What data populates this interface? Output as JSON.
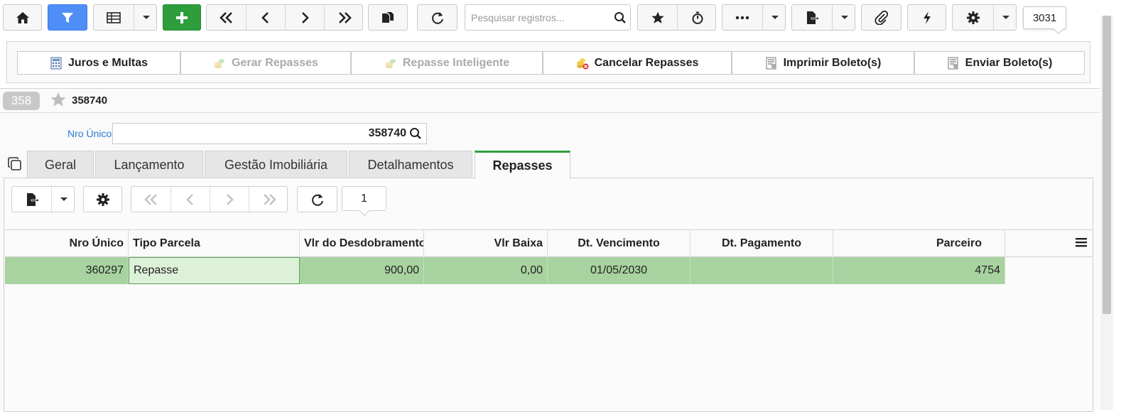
{
  "toolbar": {
    "search_placeholder": "Pesquisar registros...",
    "record_count": "3031"
  },
  "actions": [
    {
      "label": "Juros e Multas",
      "enabled": true,
      "icon": "calculator-icon"
    },
    {
      "label": "Gerar Repasses",
      "enabled": false,
      "icon": "coins-icon"
    },
    {
      "label": "Repasse Inteligente",
      "enabled": false,
      "icon": "coins-icon"
    },
    {
      "label": "Cancelar Repasses",
      "enabled": true,
      "icon": "coins-cancel-icon"
    },
    {
      "label": "Imprimir Boleto(s)",
      "enabled": true,
      "icon": "boleto-print-icon"
    },
    {
      "label": "Enviar Boleto(s)",
      "enabled": true,
      "icon": "boleto-send-icon"
    }
  ],
  "record": {
    "badge": "358",
    "title": "358740",
    "field_label": "Nro Único:",
    "field_value": "358740"
  },
  "tabs": [
    {
      "label": "Geral"
    },
    {
      "label": "Lançamento"
    },
    {
      "label": "Gestão Imobiliária"
    },
    {
      "label": "Detalhamentos"
    },
    {
      "label": "Repasses",
      "active": true
    }
  ],
  "grid": {
    "page": "1",
    "columns": [
      "Nro Único",
      "Tipo Parcela",
      "Vlr do Desdobramento",
      "Vlr Baixa",
      "Dt. Vencimento",
      "Dt. Pagamento",
      "Parceiro"
    ],
    "rows": [
      {
        "nro_unico": "360297",
        "tipo_parcela": "Repasse",
        "vlr_desdobramento": "900,00",
        "vlr_baixa": "0,00",
        "dt_vencimento": "01/05/2030",
        "dt_pagamento": "",
        "parceiro": "4754"
      }
    ]
  },
  "colors": {
    "accent_blue": "#4f8ef7",
    "accent_green": "#2e9e3c",
    "row_selected": "#a8d3a0",
    "label_blue": "#2a7bd4"
  }
}
